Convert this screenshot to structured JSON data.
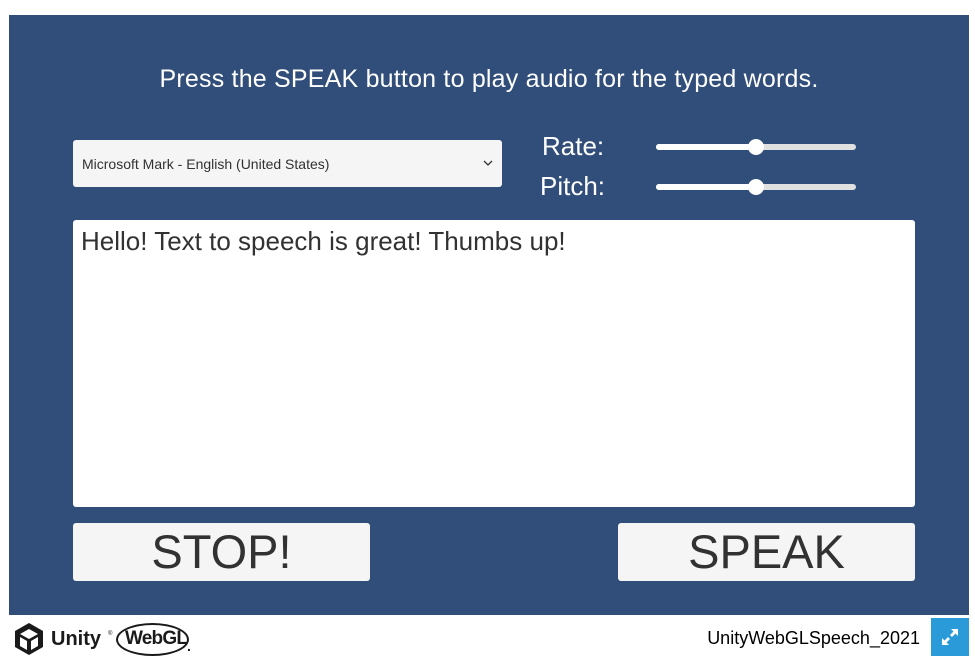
{
  "colors": {
    "panel": "#314d79",
    "accent": "#2a9bd8"
  },
  "instruction": "Press the SPEAK button to play audio for the typed words.",
  "voice": {
    "selected": "Microsoft Mark - English (United States)",
    "icon": "chevron-down-icon"
  },
  "rate": {
    "label": "Rate:",
    "value": 0.5
  },
  "pitch": {
    "label": "Pitch:",
    "value": 0.5
  },
  "text_input": {
    "value": "Hello! Text to speech is great! Thumbs up!"
  },
  "buttons": {
    "stop": "STOP!",
    "speak": "SPEAK"
  },
  "footer": {
    "unity": "Unity",
    "unity_tm": "®",
    "webgl": "WebGL",
    "webgl_dot": ".",
    "build_title": "UnityWebGLSpeech_2021",
    "fullscreen_icon": "fullscreen-icon"
  }
}
